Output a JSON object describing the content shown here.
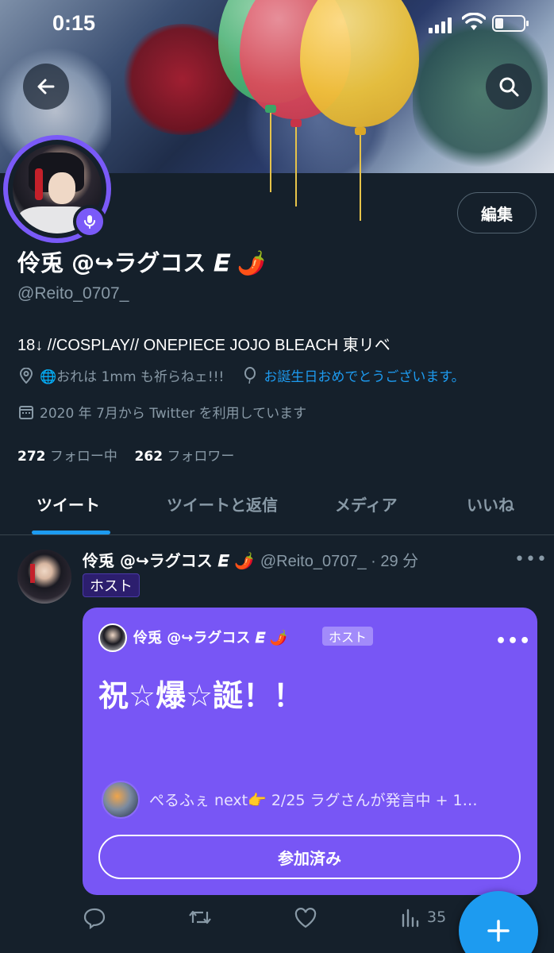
{
  "status_bar": {
    "time": "0:15"
  },
  "profile": {
    "display_name": "伶兎 @↪ラグコス 𝑬 🌶️",
    "handle": "@Reito_0707_",
    "bio": "18↓ //COSPLAY// ONEPIECE JOJO BLEACH 東リベ",
    "location": "🌐おれは 1mm も祈らねェ!!!",
    "birthday_text": "お誕生日おめでとうございます。",
    "joined": "2020 年 7月から Twitter を利用しています",
    "following_count": "272",
    "following_label": "フォロー中",
    "followers_count": "262",
    "followers_label": "フォロワー",
    "edit_button": "編集"
  },
  "tabs": [
    {
      "label": "ツイート",
      "active": true
    },
    {
      "label": "ツイートと返信",
      "active": false
    },
    {
      "label": "メディア",
      "active": false
    },
    {
      "label": "いいね",
      "active": false
    }
  ],
  "tweet": {
    "name": "伶兎 @↪ラグコス 𝑬 🌶️",
    "handle_time": "@Reito_0707_ · 29 分",
    "host_tag": "ホスト",
    "space": {
      "host_name": "伶兎 @↪ラグコス 𝑬 🌶️",
      "host_tag": "ホスト",
      "title": "祝☆爆☆誕！！",
      "listener_text": "ぺるふぇ next👉 2/25 ラグさんが発言中 + 1…",
      "joined_button": "参加済み"
    },
    "views": "35"
  },
  "colors": {
    "background": "#15202b",
    "accent": "#1d9bf0",
    "spaces_purple": "#7856f5",
    "secondary_text": "#8899a6"
  }
}
